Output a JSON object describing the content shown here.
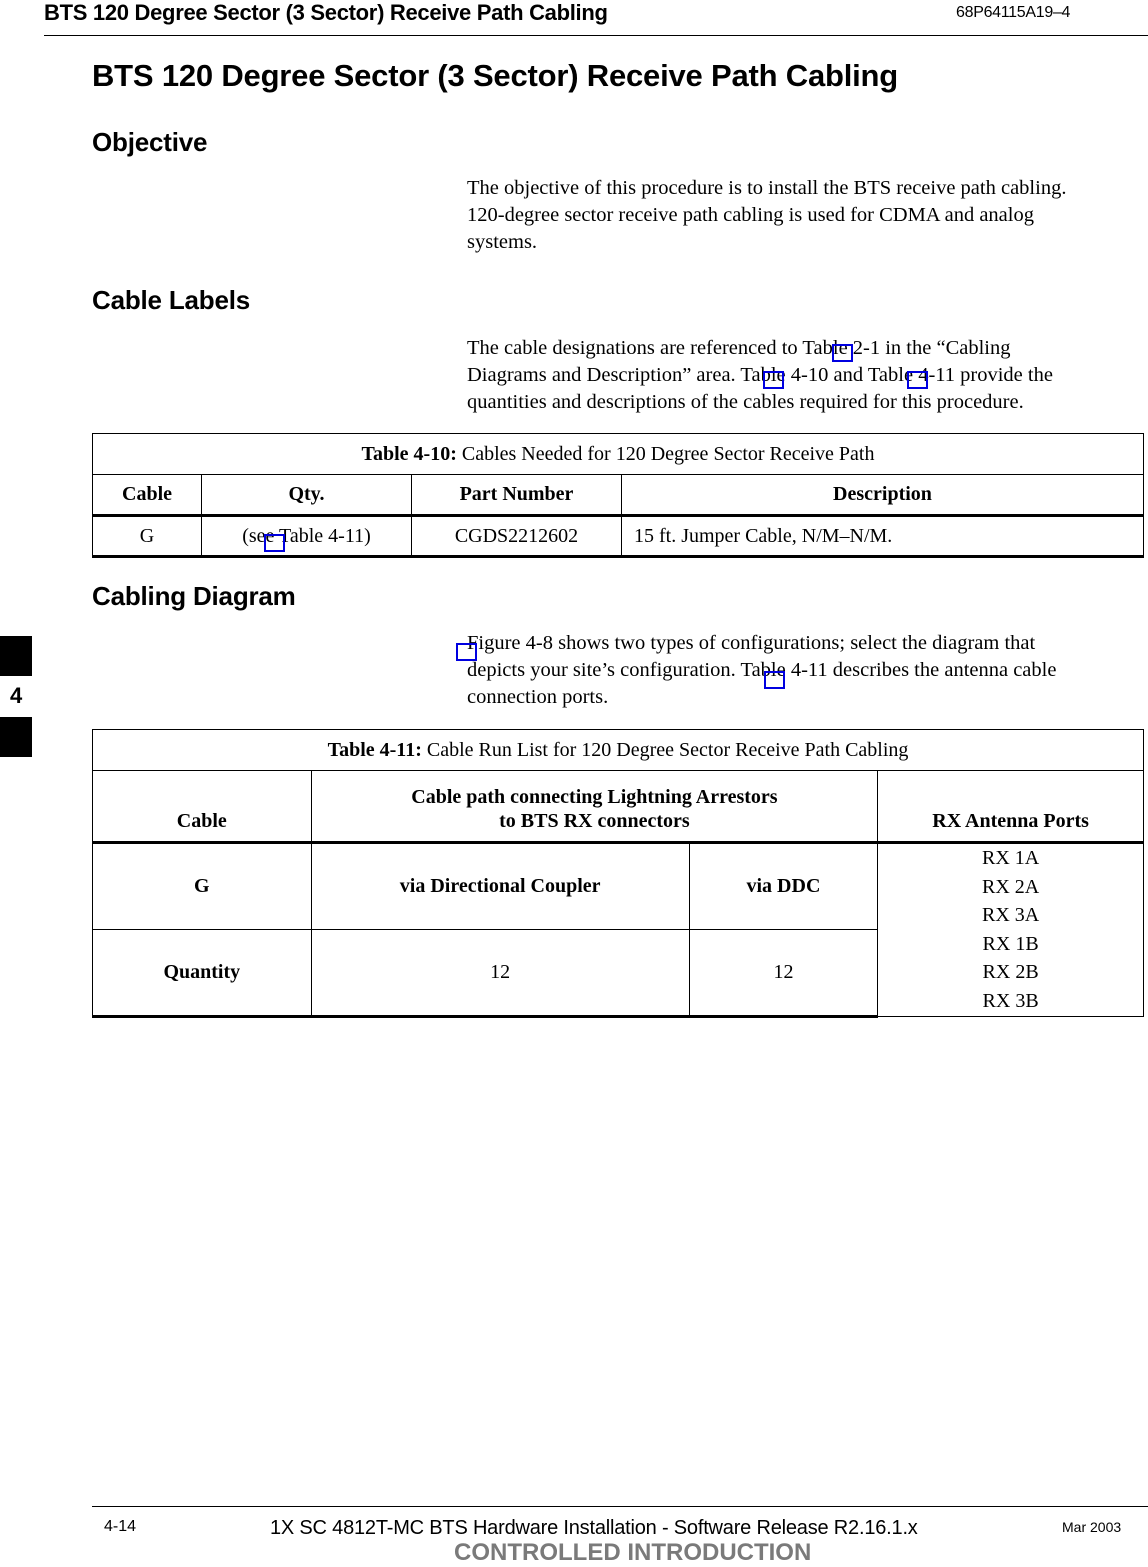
{
  "header": {
    "running_title": "BTS 120 Degree Sector (3 Sector) Receive Path Cabling",
    "doc_number": "68P64115A19–4"
  },
  "page_title": "BTS 120 Degree Sector (3 Sector) Receive Path Cabling",
  "sections": {
    "objective": {
      "heading": "Objective",
      "lines": [
        "The objective of this procedure is to install the BTS receive path cabling.",
        "120-degree sector receive path cabling is used for CDMA and analog",
        "systems."
      ]
    },
    "cable_labels": {
      "heading": "Cable Labels",
      "lines": [
        "The cable designations are referenced to Table 2-1 in the “Cabling",
        "Diagrams and Description” area. Table 4-10 and Table 4-11 provide the",
        "quantities and descriptions of the cables required for this procedure."
      ]
    },
    "cabling_diagram": {
      "heading": "Cabling Diagram",
      "lines": [
        "Figure 4-8 shows two types of configurations; select the diagram that",
        "depicts your site’s configuration. Table 4-11 describes the antenna cable",
        "connection ports."
      ]
    }
  },
  "table_4_10": {
    "caption_label": "Table 4-10:",
    "caption_text": " Cables Needed for 120 Degree Sector Receive Path",
    "columns": [
      "Cable",
      "Qty.",
      "Part Number",
      "Description"
    ],
    "rows": [
      [
        "G",
        "(see Table 4-11)",
        "CGDS2212602",
        "15 ft. Jumper Cable, N/M–N/M."
      ]
    ]
  },
  "table_4_11": {
    "caption_label": "Table 4-11:",
    "caption_text": " Cable Run List for 120 Degree Sector Receive Path Cabling",
    "columns": {
      "cable": "Cable",
      "path_line1": "Cable path connecting Lightning Arrestors",
      "path_line2": "to BTS RX connectors",
      "ports": "RX Antenna Ports"
    },
    "row_g": {
      "label": "G",
      "via_dc": "via Directional Coupler",
      "via_ddc": "via DDC"
    },
    "row_qty": {
      "label": "Quantity",
      "via_dc": "12",
      "via_ddc": "12"
    },
    "ports": [
      "RX 1A",
      "RX 2A",
      "RX 3A",
      "RX 1B",
      "RX 2B",
      "RX 3B"
    ]
  },
  "side_tab": {
    "chapter": "4"
  },
  "footer": {
    "page_number": "4-14",
    "title": "1X SC 4812T-MC BTS Hardware Installation - Software Release R2.16.1.x",
    "date": "Mar 2003",
    "classification": "CONTROLLED INTRODUCTION"
  },
  "colors": {
    "link_box": "#0000e0",
    "classification_text": "#7a7a7a"
  }
}
